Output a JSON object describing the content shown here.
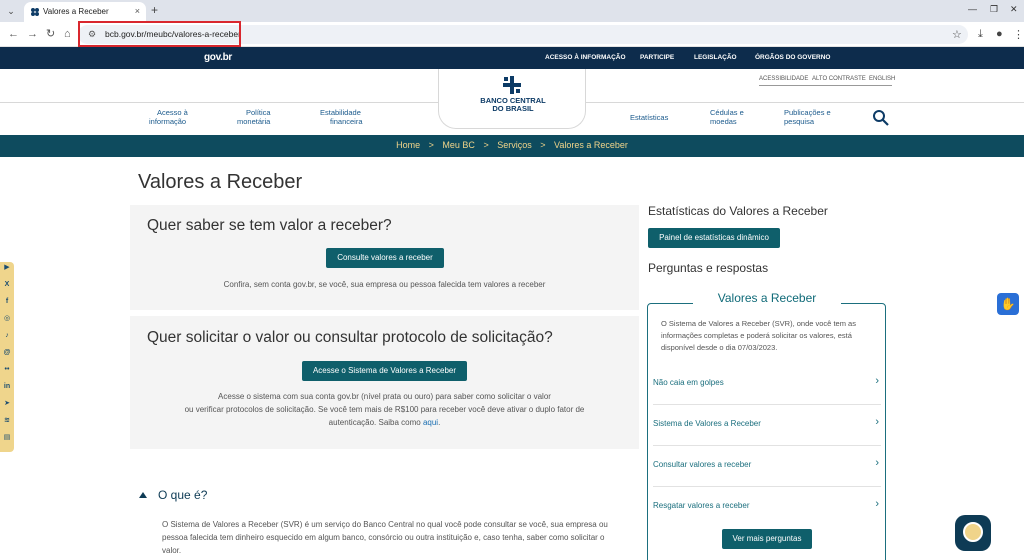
{
  "browser": {
    "tab_title": "Valores a Receber",
    "tab_close": "×",
    "new_tab": "+",
    "url": "bcb.gov.br/meubc/valores-a-receber"
  },
  "govbar": {
    "logo": "gov.br",
    "links": [
      "ACESSO À INFORMAÇÃO",
      "PARTICIPE",
      "LEGISLAÇÃO",
      "ÓRGÃOS DO GOVERNO"
    ]
  },
  "header": {
    "accessibility_links": [
      "ACESSIBILIDADE",
      "ALTO CONTRASTE",
      "ENGLISH"
    ],
    "logo_line1": "BANCO CENTRAL",
    "logo_line2": "DO BRASIL",
    "menu_left": [
      {
        "l1": "Acesso à",
        "l2": "informação"
      },
      {
        "l1": "Política",
        "l2": "monetária"
      },
      {
        "l1": "Estabilidade",
        "l2": "financeira"
      }
    ],
    "menu_right": [
      {
        "l1": "Estatísticas",
        "l2": ""
      },
      {
        "l1": "Cédulas e",
        "l2": "moedas"
      },
      {
        "l1": "Publicações e",
        "l2": "pesquisa"
      }
    ]
  },
  "breadcrumb": [
    "Home",
    "Meu BC",
    "Serviços",
    "Valores a Receber"
  ],
  "breadcrumb_sep": ">",
  "page_title": "Valores a Receber",
  "card1": {
    "title": "Quer saber se tem valor a receber?",
    "button": "Consulte valores a receber",
    "text": "Confira, sem conta gov.br, se você, sua empresa ou pessoa falecida tem valores a receber"
  },
  "card2": {
    "title": "Quer solicitar o valor ou consultar protocolo de solicitação?",
    "button": "Acesse o Sistema de Valores a Receber",
    "text_l1": "Acesse o sistema com sua conta gov.br (nível prata ou ouro) para saber como solicitar o valor",
    "text_l2": "ou verificar protocolos de solicitação. Se você tem mais de R$100 para receber você deve ativar o duplo fator de",
    "text_l3": "autenticação. Saiba como ",
    "text_link": "aqui",
    "text_end": "."
  },
  "oque": {
    "title": "O que é?",
    "text": "O Sistema de Valores a Receber (SVR) é um serviço do Banco Central no qual você pode consultar se você, sua empresa ou pessoa falecida tem dinheiro esquecido em algum banco, consórcio ou outra instituição e, caso tenha, saber como solicitar o valor."
  },
  "sidebar": {
    "stats_title": "Estatísticas do Valores a Receber",
    "stats_button": "Painel de estatísticas dinâmico",
    "faq_heading": "Perguntas e respostas",
    "faq_box_title": "Valores a Receber",
    "faq_intro": "O Sistema de Valores a Receber (SVR), onde você tem as informações completas e poderá solicitar os valores, está disponível desde o dia 07/03/2023.",
    "faq_items": [
      "Não caia em golpes",
      "Sistema de Valores a Receber",
      "Consultar valores a receber",
      "Resgatar valores a receber"
    ],
    "faq_more": "Ver mais perguntas"
  }
}
